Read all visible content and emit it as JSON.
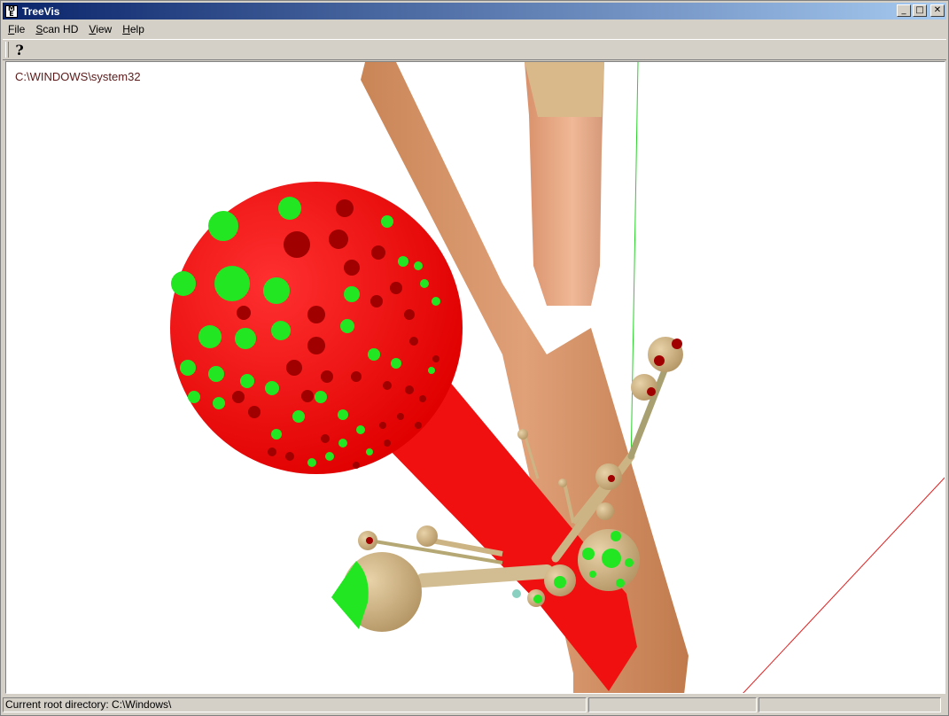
{
  "window": {
    "title": "TreeVis"
  },
  "menu": {
    "items": [
      {
        "label_pre": "",
        "label_key": "F",
        "label_post": "ile"
      },
      {
        "label_pre": "",
        "label_key": "S",
        "label_post": "can HD"
      },
      {
        "label_pre": "",
        "label_key": "V",
        "label_post": "iew"
      },
      {
        "label_pre": "",
        "label_key": "H",
        "label_post": "elp"
      }
    ]
  },
  "toolbar": {
    "help_glyph": "?"
  },
  "viewport": {
    "path_label": "C:\\WINDOWS\\system32",
    "colors": {
      "trunk": "#d99a6c",
      "selected": "#ff1a1a",
      "file_dot": "#22e622",
      "dark_dot": "#a00000",
      "node": "#d8bd8a"
    }
  },
  "status": {
    "main": "Current root directory: C:\\Windows\\",
    "pane2": "",
    "pane3": ""
  }
}
